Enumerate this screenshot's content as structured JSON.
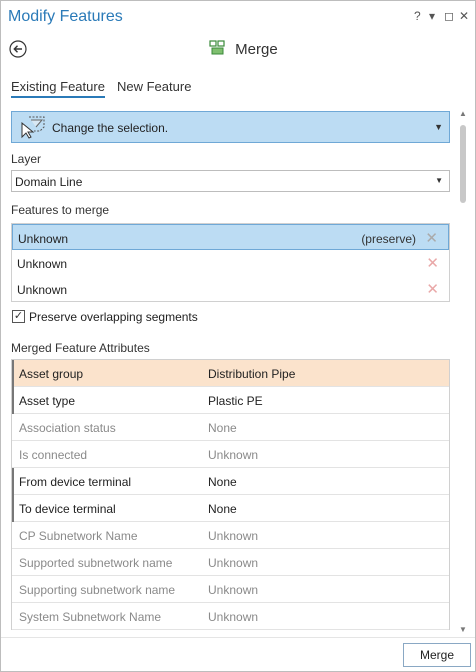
{
  "window": {
    "title": "Modify Features",
    "help_label": "?",
    "menu_label": "▾",
    "float_label": "◻",
    "close_label": "✕"
  },
  "tool": {
    "title": "Merge",
    "back_icon": "back-arrow-icon",
    "tool_icon": "merge-icon"
  },
  "tabs": [
    {
      "label": "Existing Feature",
      "active": true
    },
    {
      "label": "New Feature",
      "active": false
    }
  ],
  "selection_tool": {
    "label": "Change the selection.",
    "icon": "select-cursor-icon"
  },
  "layer": {
    "label": "Layer",
    "value": "Domain Line"
  },
  "features": {
    "label": "Features to merge",
    "items": [
      {
        "name": "Unknown",
        "tag": "(preserve)",
        "selected": true
      },
      {
        "name": "Unknown",
        "tag": "",
        "selected": false
      },
      {
        "name": "Unknown",
        "tag": "",
        "selected": false
      }
    ]
  },
  "preserve": {
    "checked": true,
    "label": "Preserve overlapping segments"
  },
  "attributes": {
    "label": "Merged Feature Attributes",
    "rows": [
      {
        "key": "Asset group",
        "value": "Distribution Pipe",
        "state": "highlight"
      },
      {
        "key": "Asset type",
        "value": "Plastic PE",
        "state": "edit"
      },
      {
        "key": "Association status",
        "value": "None",
        "state": "disabled"
      },
      {
        "key": "Is connected",
        "value": "Unknown",
        "state": "disabled"
      },
      {
        "key": "From device terminal",
        "value": "None",
        "state": "edit"
      },
      {
        "key": "To device terminal",
        "value": "None",
        "state": "edit"
      },
      {
        "key": "CP Subnetwork Name",
        "value": "Unknown",
        "state": "disabled"
      },
      {
        "key": "Supported subnetwork name",
        "value": "Unknown",
        "state": "disabled"
      },
      {
        "key": "Supporting subnetwork name",
        "value": "Unknown",
        "state": "disabled"
      },
      {
        "key": "System Subnetwork Name",
        "value": "Unknown",
        "state": "disabled"
      }
    ]
  },
  "footer": {
    "merge_label": "Merge"
  },
  "colors": {
    "accent": "#2a7ab8",
    "selection": "#bcdcf3",
    "highlight_row": "#fbe3cc"
  }
}
